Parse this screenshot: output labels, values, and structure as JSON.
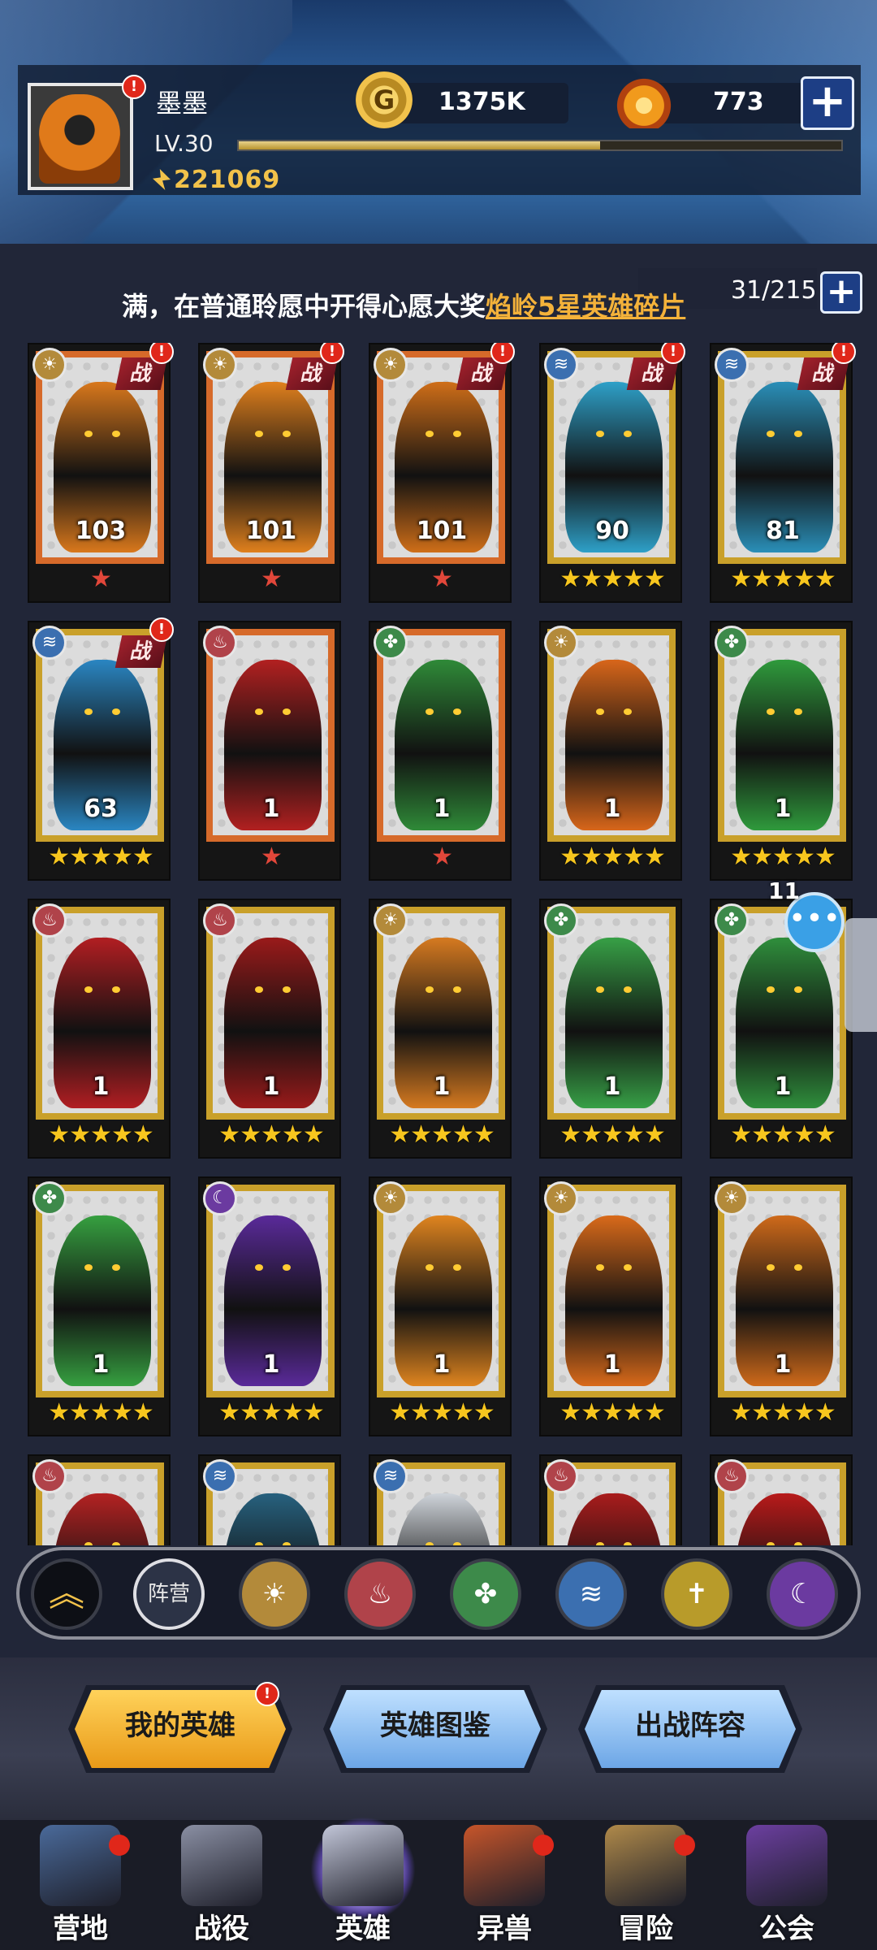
{
  "player": {
    "name": "墨墨",
    "level": "LV.30",
    "xp_fraction": 0.6,
    "power": "221069",
    "gold": "1375K",
    "gems": "773"
  },
  "announcement": {
    "text": "满，在普通聆愿中开得心愿大奖",
    "highlight": "焰岭5星英雄碎片",
    "capacity": "31/215"
  },
  "battle_tag": "战",
  "heroes": [
    {
      "faction": "sun",
      "level": "103",
      "stars": 1,
      "star_type": "red",
      "battle": true,
      "alert": true,
      "color": "#d9781c"
    },
    {
      "faction": "sun",
      "level": "101",
      "stars": 1,
      "star_type": "red",
      "battle": true,
      "alert": true,
      "color": "#e0801d"
    },
    {
      "faction": "sun",
      "level": "101",
      "stars": 1,
      "star_type": "red",
      "battle": true,
      "alert": true,
      "color": "#cf6e18"
    },
    {
      "faction": "water",
      "level": "90",
      "stars": 5,
      "star_type": "gold",
      "battle": true,
      "alert": true,
      "color": "#2ea0c8"
    },
    {
      "faction": "water",
      "level": "81",
      "stars": 5,
      "star_type": "gold",
      "battle": true,
      "alert": true,
      "color": "#2a8fb8"
    },
    {
      "faction": "water",
      "level": "63",
      "stars": 5,
      "star_type": "gold",
      "battle": true,
      "alert": true,
      "color": "#2a86c2"
    },
    {
      "faction": "fire",
      "level": "1",
      "stars": 1,
      "star_type": "red",
      "battle": false,
      "alert": false,
      "color": "#b22020"
    },
    {
      "faction": "wood",
      "level": "1",
      "stars": 1,
      "star_type": "red",
      "battle": false,
      "alert": false,
      "color": "#2f8a38"
    },
    {
      "faction": "sun",
      "level": "1",
      "stars": 5,
      "star_type": "gold",
      "battle": false,
      "alert": false,
      "color": "#d8661a"
    },
    {
      "faction": "wood",
      "level": "1",
      "stars": 5,
      "star_type": "gold",
      "battle": false,
      "alert": false,
      "color": "#2f9a3c"
    },
    {
      "faction": "fire",
      "level": "1",
      "stars": 5,
      "star_type": "gold",
      "battle": false,
      "alert": false,
      "color": "#b21e22"
    },
    {
      "faction": "fire",
      "level": "1",
      "stars": 5,
      "star_type": "gold",
      "battle": false,
      "alert": false,
      "color": "#9a1a1a"
    },
    {
      "faction": "sun",
      "level": "1",
      "stars": 5,
      "star_type": "gold",
      "battle": false,
      "alert": false,
      "color": "#d67a20"
    },
    {
      "faction": "wood",
      "level": "1",
      "stars": 5,
      "star_type": "gold",
      "battle": false,
      "alert": false,
      "color": "#37a046"
    },
    {
      "faction": "wood",
      "level": "1",
      "stars": 5,
      "star_type": "gold",
      "battle": false,
      "alert": false,
      "color": "#2f8f3c"
    },
    {
      "faction": "wood",
      "level": "1",
      "stars": 5,
      "star_type": "gold",
      "battle": false,
      "alert": false,
      "color": "#36a040"
    },
    {
      "faction": "dark",
      "level": "1",
      "stars": 5,
      "star_type": "gold",
      "battle": false,
      "alert": false,
      "color": "#5a2a9a"
    },
    {
      "faction": "sun",
      "level": "1",
      "stars": 5,
      "star_type": "gold",
      "battle": false,
      "alert": false,
      "color": "#e0851f"
    },
    {
      "faction": "sun",
      "level": "1",
      "stars": 5,
      "star_type": "gold",
      "battle": false,
      "alert": false,
      "color": "#d96a1a"
    },
    {
      "faction": "sun",
      "level": "1",
      "stars": 5,
      "star_type": "gold",
      "battle": false,
      "alert": false,
      "color": "#cf6a1a"
    },
    {
      "faction": "fire",
      "level": "",
      "stars": 0,
      "star_type": "gold",
      "battle": false,
      "alert": false,
      "color": "#b42222"
    },
    {
      "faction": "water",
      "level": "",
      "stars": 0,
      "star_type": "gold",
      "battle": false,
      "alert": false,
      "color": "#27617e"
    },
    {
      "faction": "water",
      "level": "",
      "stars": 0,
      "star_type": "gold",
      "battle": false,
      "alert": false,
      "color": "#cfd4da"
    },
    {
      "faction": "fire",
      "level": "",
      "stars": 0,
      "star_type": "gold",
      "battle": false,
      "alert": false,
      "color": "#a91c1c"
    },
    {
      "faction": "fire",
      "level": "",
      "stars": 0,
      "star_type": "gold",
      "battle": false,
      "alert": false,
      "color": "#b81a1a"
    }
  ],
  "chat": {
    "count": "11"
  },
  "filters": {
    "collapse_icon": "chevron-up-icon",
    "camp_label": "阵营",
    "factions": [
      "sun",
      "fire",
      "wood",
      "water",
      "holy",
      "dark"
    ]
  },
  "tabs": [
    {
      "label": "我的英雄",
      "active": true,
      "alert": true
    },
    {
      "label": "英雄图鉴",
      "active": false,
      "alert": false
    },
    {
      "label": "出战阵容",
      "active": false,
      "alert": false
    }
  ],
  "nav": [
    {
      "label": "营地",
      "icon": "camp-icon",
      "dot": true,
      "active": false
    },
    {
      "label": "战役",
      "icon": "campaign-icon",
      "dot": false,
      "active": false
    },
    {
      "label": "英雄",
      "icon": "hero-icon",
      "dot": false,
      "active": true
    },
    {
      "label": "异兽",
      "icon": "beast-icon",
      "dot": true,
      "active": false
    },
    {
      "label": "冒险",
      "icon": "adventure-icon",
      "dot": true,
      "active": false
    },
    {
      "label": "公会",
      "icon": "guild-icon",
      "dot": false,
      "active": false
    }
  ],
  "colors": {
    "accent_gold": "#f2c24a",
    "alert_red": "#e0271a",
    "tab_active": "#f0b030",
    "tab_inactive": "#7fb6ee"
  }
}
